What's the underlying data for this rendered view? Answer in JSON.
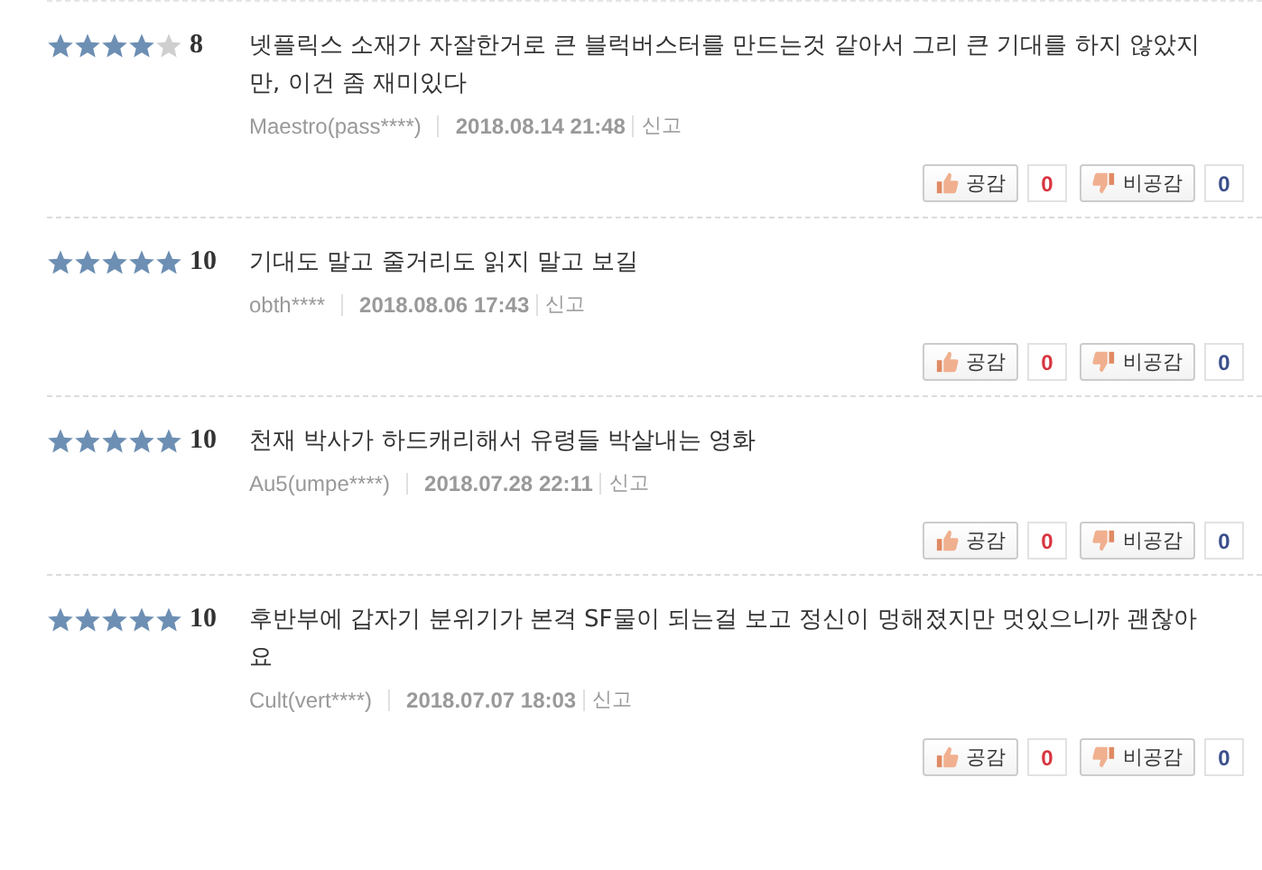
{
  "reviews": [
    {
      "stars": 4,
      "score": "8",
      "text": "넷플릭스 소재가 자잘한거로 큰 블럭버스터를 만드는것 같아서 그리 큰 기대를 하지 않았지만, 이건 좀 재미있다",
      "author": "Maestro(pass****)",
      "date": "2018.08.14 21:48",
      "report": "신고",
      "like_label": "공감",
      "like_count": "0",
      "dislike_label": "비공감",
      "dislike_count": "0"
    },
    {
      "stars": 5,
      "score": "10",
      "text": "기대도 말고 줄거리도 읽지 말고 보길",
      "author": "obth****",
      "date": "2018.08.06 17:43",
      "report": "신고",
      "like_label": "공감",
      "like_count": "0",
      "dislike_label": "비공감",
      "dislike_count": "0"
    },
    {
      "stars": 5,
      "score": "10",
      "text": "천재 박사가 하드캐리해서 유령들 박살내는 영화",
      "author": "Au5(umpe****)",
      "date": "2018.07.28 22:11",
      "report": "신고",
      "like_label": "공감",
      "like_count": "0",
      "dislike_label": "비공감",
      "dislike_count": "0"
    },
    {
      "stars": 5,
      "score": "10",
      "text": "후반부에 갑자기 분위기가 본격 SF물이 되는걸 보고 정신이 멍해졌지만 멋있으니까 괜찮아요",
      "author": "Cult(vert****)",
      "date": "2018.07.07 18:03",
      "report": "신고",
      "like_label": "공감",
      "like_count": "0",
      "dislike_label": "비공감",
      "dislike_count": "0"
    }
  ]
}
